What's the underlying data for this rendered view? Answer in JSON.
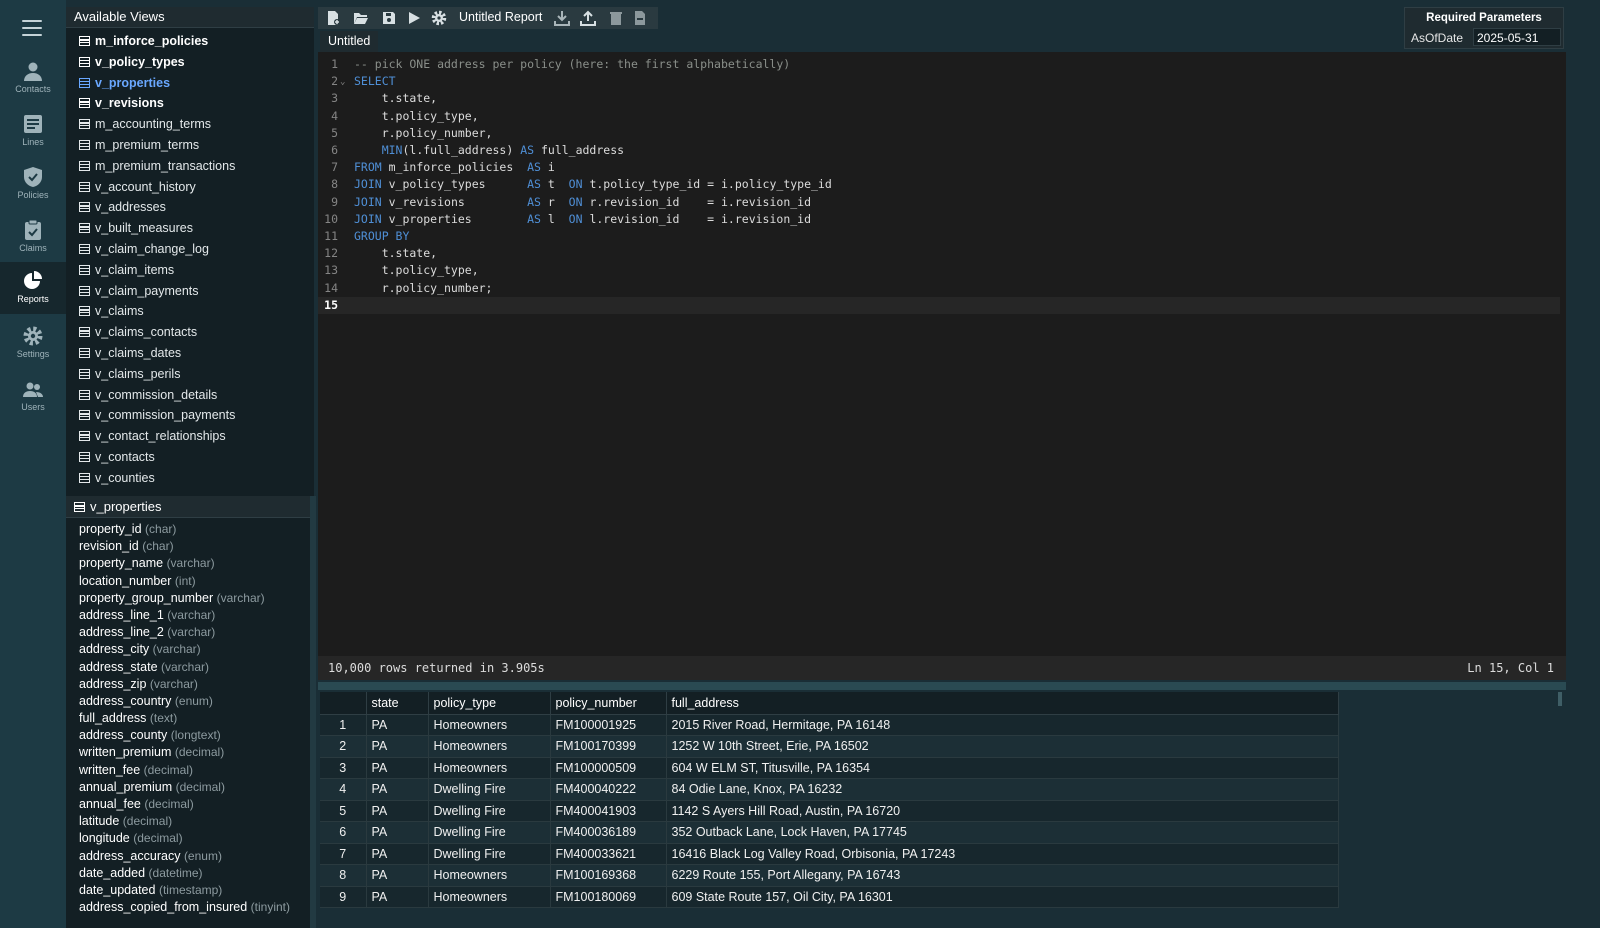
{
  "nav": {
    "items": [
      {
        "label": "Contacts",
        "icon": "person-icon"
      },
      {
        "label": "Lines",
        "icon": "list-icon"
      },
      {
        "label": "Policies",
        "icon": "shield-icon"
      },
      {
        "label": "Claims",
        "icon": "clipboard-icon"
      },
      {
        "label": "Reports",
        "icon": "pie-chart-icon",
        "active": true
      },
      {
        "label": "Settings",
        "icon": "gear-icon"
      },
      {
        "label": "Users",
        "icon": "users-icon"
      }
    ]
  },
  "views": {
    "title": "Available Views",
    "items": [
      {
        "name": "m_inforce_policies",
        "bold": true
      },
      {
        "name": "v_policy_types",
        "bold": true
      },
      {
        "name": "v_properties",
        "bold": true,
        "selected": true
      },
      {
        "name": "v_revisions",
        "bold": true
      },
      {
        "name": "m_accounting_terms"
      },
      {
        "name": "m_premium_terms"
      },
      {
        "name": "m_premium_transactions"
      },
      {
        "name": "v_account_history"
      },
      {
        "name": "v_addresses"
      },
      {
        "name": "v_built_measures"
      },
      {
        "name": "v_claim_change_log"
      },
      {
        "name": "v_claim_items"
      },
      {
        "name": "v_claim_payments"
      },
      {
        "name": "v_claims"
      },
      {
        "name": "v_claims_contacts"
      },
      {
        "name": "v_claims_dates"
      },
      {
        "name": "v_claims_perils"
      },
      {
        "name": "v_commission_details"
      },
      {
        "name": "v_commission_payments"
      },
      {
        "name": "v_contact_relationships"
      },
      {
        "name": "v_contacts"
      },
      {
        "name": "v_counties"
      }
    ]
  },
  "columns": {
    "title": "v_properties",
    "items": [
      {
        "name": "property_id",
        "type": "(char)"
      },
      {
        "name": "revision_id",
        "type": "(char)"
      },
      {
        "name": "property_name",
        "type": "(varchar)"
      },
      {
        "name": "location_number",
        "type": "(int)"
      },
      {
        "name": "property_group_number",
        "type": "(varchar)"
      },
      {
        "name": "address_line_1",
        "type": "(varchar)"
      },
      {
        "name": "address_line_2",
        "type": "(varchar)"
      },
      {
        "name": "address_city",
        "type": "(varchar)"
      },
      {
        "name": "address_state",
        "type": "(varchar)"
      },
      {
        "name": "address_zip",
        "type": "(varchar)"
      },
      {
        "name": "address_country",
        "type": "(enum)"
      },
      {
        "name": "full_address",
        "type": "(text)"
      },
      {
        "name": "address_county",
        "type": "(longtext)"
      },
      {
        "name": "written_premium",
        "type": "(decimal)"
      },
      {
        "name": "written_fee",
        "type": "(decimal)"
      },
      {
        "name": "annual_premium",
        "type": "(decimal)"
      },
      {
        "name": "annual_fee",
        "type": "(decimal)"
      },
      {
        "name": "latitude",
        "type": "(decimal)"
      },
      {
        "name": "longitude",
        "type": "(decimal)"
      },
      {
        "name": "address_accuracy",
        "type": "(enum)"
      },
      {
        "name": "date_added",
        "type": "(datetime)"
      },
      {
        "name": "date_updated",
        "type": "(timestamp)"
      },
      {
        "name": "address_copied_from_insured",
        "type": "(tinyint)"
      }
    ]
  },
  "toolbar": {
    "report_title": "Untitled Report",
    "buttons": [
      "new-file-icon",
      "open-folder-icon",
      "save-icon",
      "play-icon",
      "gear-icon",
      "download-icon",
      "upload-icon",
      "trash-icon",
      "export-file-icon"
    ]
  },
  "params": {
    "title": "Required Parameters",
    "label": "AsOfDate",
    "value": "2025-05-31"
  },
  "editor": {
    "tab": "Untitled",
    "lines": [
      [
        {
          "t": "-- pick ONE address per policy (here: the first alphabetically)",
          "c": "cmt"
        }
      ],
      [
        {
          "t": "SELECT",
          "c": "kw"
        }
      ],
      [
        {
          "t": "    t.state,",
          "c": "code"
        }
      ],
      [
        {
          "t": "    t.policy_type,",
          "c": "code"
        }
      ],
      [
        {
          "t": "    r.policy_number,",
          "c": "code"
        }
      ],
      [
        {
          "t": "    ",
          "c": "code"
        },
        {
          "t": "MIN",
          "c": "kw"
        },
        {
          "t": "(l.full_address) ",
          "c": "code"
        },
        {
          "t": "AS",
          "c": "kw"
        },
        {
          "t": " full_address",
          "c": "code"
        }
      ],
      [
        {
          "t": "FROM",
          "c": "kw"
        },
        {
          "t": " m_inforce_policies  ",
          "c": "code"
        },
        {
          "t": "AS",
          "c": "kw"
        },
        {
          "t": " i",
          "c": "code"
        }
      ],
      [
        {
          "t": "JOIN",
          "c": "kw"
        },
        {
          "t": " v_policy_types      ",
          "c": "code"
        },
        {
          "t": "AS",
          "c": "kw"
        },
        {
          "t": " t  ",
          "c": "code"
        },
        {
          "t": "ON",
          "c": "kw"
        },
        {
          "t": " t.policy_type_id = i.policy_type_id",
          "c": "code"
        }
      ],
      [
        {
          "t": "JOIN",
          "c": "kw"
        },
        {
          "t": " v_revisions         ",
          "c": "code"
        },
        {
          "t": "AS",
          "c": "kw"
        },
        {
          "t": " r  ",
          "c": "code"
        },
        {
          "t": "ON",
          "c": "kw"
        },
        {
          "t": " r.revision_id    = i.revision_id",
          "c": "code"
        }
      ],
      [
        {
          "t": "JOIN",
          "c": "kw"
        },
        {
          "t": " v_properties        ",
          "c": "code"
        },
        {
          "t": "AS",
          "c": "kw"
        },
        {
          "t": " l  ",
          "c": "code"
        },
        {
          "t": "ON",
          "c": "kw"
        },
        {
          "t": " l.revision_id    = i.revision_id",
          "c": "code"
        }
      ],
      [
        {
          "t": "GROUP BY",
          "c": "kw"
        }
      ],
      [
        {
          "t": "    t.state,",
          "c": "code"
        }
      ],
      [
        {
          "t": "    t.policy_type,",
          "c": "code"
        }
      ],
      [
        {
          "t": "    r.policy_number;",
          "c": "code"
        }
      ],
      [
        {
          "t": "",
          "c": "code"
        }
      ]
    ],
    "current_line": 15
  },
  "status": {
    "message": "10,000 rows returned in 3.905s",
    "position": "Ln 15, Col 1"
  },
  "results": {
    "columns": [
      "",
      "state",
      "policy_type",
      "policy_number",
      "full_address"
    ],
    "rows": [
      [
        "1",
        "PA",
        "Homeowners",
        "FM100001925",
        "2015 River Road, Hermitage, PA 16148"
      ],
      [
        "2",
        "PA",
        "Homeowners",
        "FM100170399",
        "1252 W 10th Street, Erie, PA 16502"
      ],
      [
        "3",
        "PA",
        "Homeowners",
        "FM100000509",
        "604 W ELM ST, Titusville, PA 16354"
      ],
      [
        "4",
        "PA",
        "Dwelling Fire",
        "FM400040222",
        "84 Odie Lane, Knox, PA 16232"
      ],
      [
        "5",
        "PA",
        "Dwelling Fire",
        "FM400041903",
        "1142 S Ayers Hill Road, Austin, PA 16720"
      ],
      [
        "6",
        "PA",
        "Dwelling Fire",
        "FM400036189",
        "352 Outback Lane, Lock Haven, PA 17745"
      ],
      [
        "7",
        "PA",
        "Dwelling Fire",
        "FM400033621",
        "16416 Black Log Valley Road, Orbisonia, PA 17243"
      ],
      [
        "8",
        "PA",
        "Homeowners",
        "FM100169368",
        "6229 Route 155, Port Allegany, PA 16743"
      ],
      [
        "9",
        "PA",
        "Homeowners",
        "FM100180069",
        "609 State Route 157, Oil City, PA 16301"
      ]
    ]
  }
}
